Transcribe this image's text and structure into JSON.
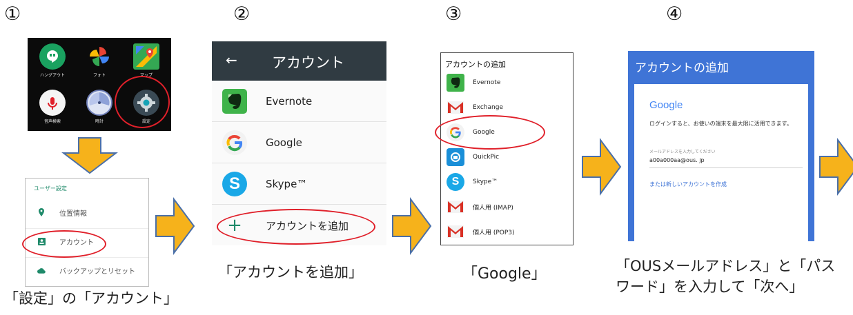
{
  "steps": {
    "one": {
      "number": "①",
      "apps": [
        {
          "label": "ハングアウト",
          "icon": "hangouts-icon",
          "color": "#1aa260"
        },
        {
          "label": "フォト",
          "icon": "photos-icon",
          "color": "#f4b400"
        },
        {
          "label": "マップ",
          "icon": "maps-icon",
          "color": "#34a853"
        },
        {
          "label": "音声検索",
          "icon": "voice-search-icon",
          "color": "#f5f5f5"
        },
        {
          "label": "時計",
          "icon": "clock-icon",
          "color": "#6f7fb8"
        },
        {
          "label": "設定",
          "icon": "settings-icon",
          "color": "#3a4a55"
        }
      ],
      "user_settings": {
        "header": "ユーザー設定",
        "items": [
          {
            "label": "位置情報",
            "icon": "location-icon"
          },
          {
            "label": "アカウント",
            "icon": "account-icon"
          },
          {
            "label": "バックアップとリセット",
            "icon": "cloud-backup-icon"
          }
        ]
      },
      "caption": "「設定」の「アカウント」"
    },
    "two": {
      "number": "②",
      "toolbar_title": "アカウント",
      "back_glyph": "←",
      "accounts": [
        {
          "label": "Evernote",
          "icon": "evernote-icon"
        },
        {
          "label": "Google",
          "icon": "google-icon"
        },
        {
          "label": "Skype™",
          "icon": "skype-icon"
        }
      ],
      "add_glyph": "+",
      "add_label": "アカウントを追加",
      "caption": "「アカウントを追加」"
    },
    "three": {
      "number": "③",
      "title": "アカウントの追加",
      "items": [
        {
          "label": "Evernote",
          "icon": "evernote-icon"
        },
        {
          "label": "Exchange",
          "icon": "gmail-icon"
        },
        {
          "label": "Google",
          "icon": "google-icon"
        },
        {
          "label": "QuickPic",
          "icon": "quickpic-icon"
        },
        {
          "label": "Skype™",
          "icon": "skype-icon"
        },
        {
          "label": "個人用 (IMAP)",
          "icon": "gmail-icon"
        },
        {
          "label": "個人用 (POP3)",
          "icon": "gmail-icon"
        }
      ],
      "caption": "「Google」"
    },
    "four": {
      "number": "④",
      "header": "アカウントの追加",
      "logo": "Google",
      "intro": "ログインすると、お使いの端末を最大限に活用できます。",
      "field_label": "メールアドレスを入力してください",
      "field_value": "a00a000aa@ous. jp",
      "create_link": "または新しいアカウントを作成",
      "caption": "「OUSメールアドレス」と「パス\nワード」を入力して「次へ」"
    }
  },
  "colors": {
    "arrow": "#f6b21b",
    "arrow_edge": "#4a6fa8",
    "highlight": "#e0202a",
    "step4_blue": "#3f74d6",
    "step2_bar": "#303b42"
  }
}
